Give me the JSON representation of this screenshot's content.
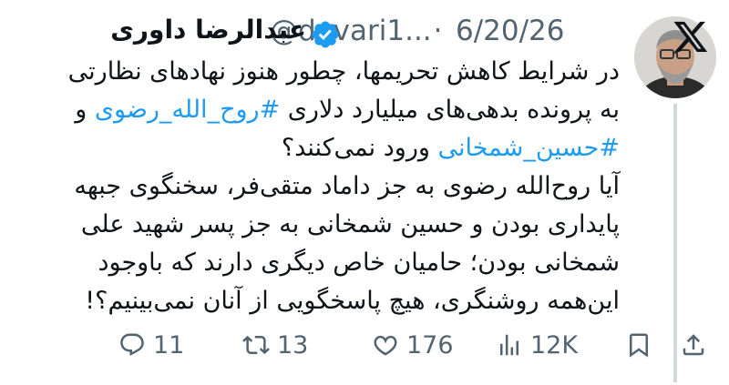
{
  "tweet": {
    "author_name": "عبدالرضا داوری",
    "handle": "@davari1...",
    "separator": "·",
    "date": "6/20/26",
    "verified_icon": "verified-badge-icon",
    "platform_icon": "x-logo-icon",
    "lines": [
      {
        "parts": [
          {
            "text": "در شرایط کاهش تحریمها، چطور هنوز نهادهای نظارتی",
            "hashtag": false
          }
        ]
      },
      {
        "parts": [
          {
            "text": "به پرونده بدهی‌های میلیارد دلاری ",
            "hashtag": false
          },
          {
            "text": "#روح_الله_رضوی",
            "hashtag": true
          },
          {
            "text": " و",
            "hashtag": false
          }
        ]
      },
      {
        "parts": [
          {
            "text": "#حسین_شمخانی",
            "hashtag": true
          },
          {
            "text": " ورود نمی‌کنند؟",
            "hashtag": false
          }
        ]
      },
      {
        "parts": [
          {
            "text": "آیا روح‌الله رضوی به جز داماد متقی‌فر، سخنگوی جبهه",
            "hashtag": false
          }
        ]
      },
      {
        "parts": [
          {
            "text": "پایداری بودن و حسین شمخانی به جز پسر شهید علی",
            "hashtag": false
          }
        ]
      },
      {
        "parts": [
          {
            "text": "شمخانی بودن؛ حامیان خاص دیگری دارند که باوجود",
            "hashtag": false
          }
        ]
      },
      {
        "parts": [
          {
            "text": "این‌همه روشنگری، هیچ پاسخگویی از آنان نمی‌بینیم؟!",
            "hashtag": false
          }
        ]
      }
    ],
    "actions": {
      "reply": {
        "icon": "reply-icon",
        "count": "11"
      },
      "retweet": {
        "icon": "retweet-icon",
        "count": "13"
      },
      "like": {
        "icon": "heart-icon",
        "count": "176"
      },
      "views": {
        "icon": "views-chart-icon",
        "count": "12K"
      },
      "bookmark": {
        "icon": "bookmark-icon"
      },
      "share": {
        "icon": "share-icon"
      }
    },
    "colors": {
      "text": "#0f1419",
      "secondary": "#536471",
      "accent": "#1d9bf0",
      "thread_line": "#cfd9de"
    }
  }
}
